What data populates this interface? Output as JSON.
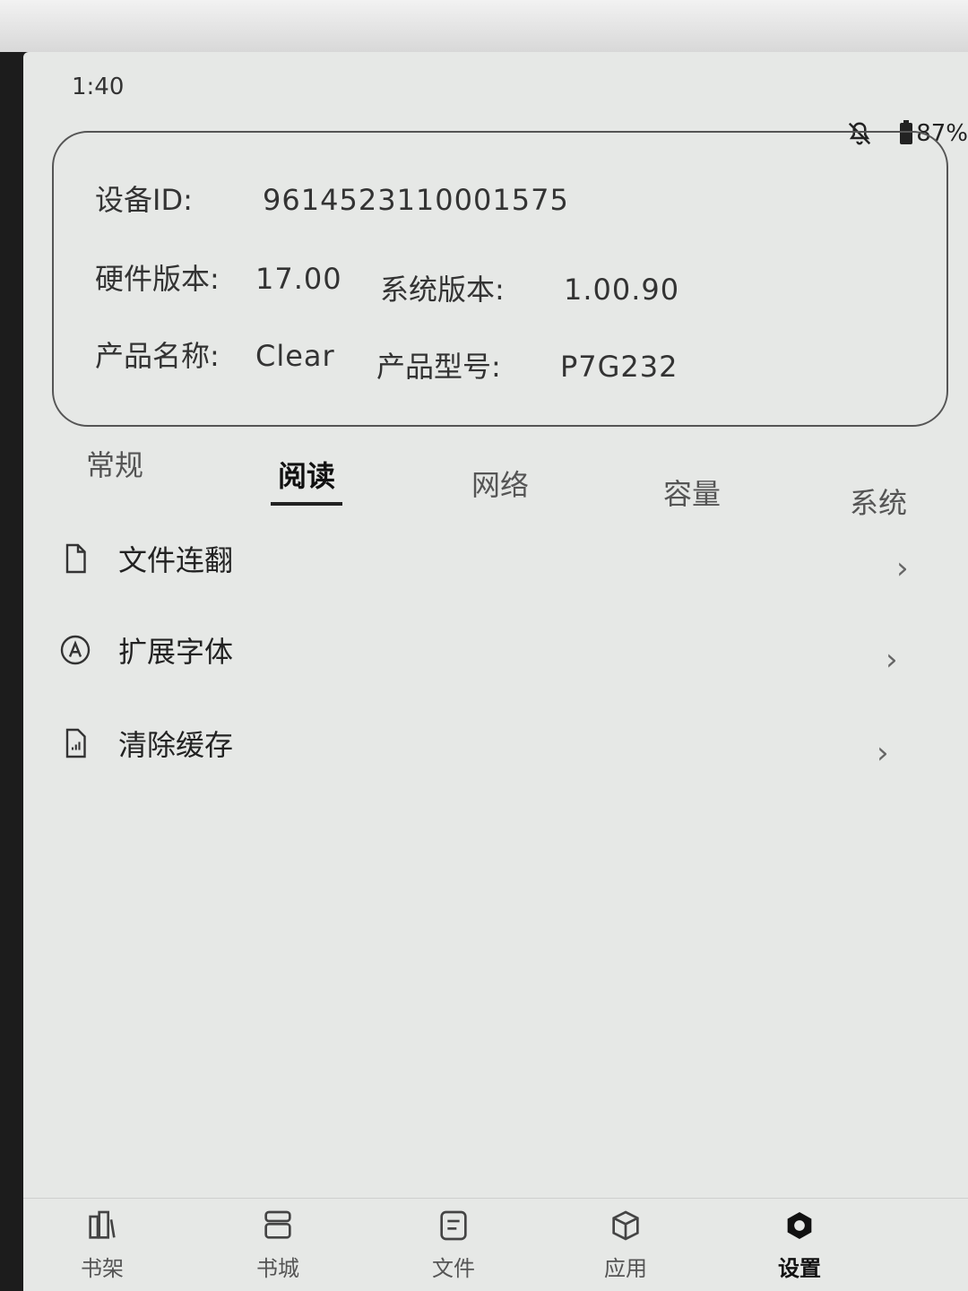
{
  "status_bar": {
    "time": "1:40",
    "battery": "87%"
  },
  "device_info": {
    "device_id_label": "设备ID:",
    "device_id_value": "9614523110001575",
    "hardware_label": "硬件版本:",
    "hardware_value": "17.00",
    "system_label": "系统版本:",
    "system_value": "1.00.90",
    "product_name_label": "产品名称:",
    "product_name_value": "Clear",
    "product_model_label": "产品型号:",
    "product_model_value": "P7G232"
  },
  "tabs": [
    {
      "label": "常规",
      "active": false
    },
    {
      "label": "阅读",
      "active": true
    },
    {
      "label": "网络",
      "active": false
    },
    {
      "label": "容量",
      "active": false
    },
    {
      "label": "系统",
      "active": false
    }
  ],
  "settings_items": [
    {
      "label": "文件连翻",
      "icon": "file-icon"
    },
    {
      "label": "扩展字体",
      "icon": "font-icon"
    },
    {
      "label": "清除缓存",
      "icon": "cache-icon"
    }
  ],
  "bottom_nav": [
    {
      "label": "书架",
      "icon": "bookshelf-icon",
      "active": false
    },
    {
      "label": "书城",
      "icon": "bookstore-icon",
      "active": false
    },
    {
      "label": "文件",
      "icon": "files-icon",
      "active": false
    },
    {
      "label": "应用",
      "icon": "apps-icon",
      "active": false
    },
    {
      "label": "设置",
      "icon": "settings-icon",
      "active": true
    }
  ]
}
